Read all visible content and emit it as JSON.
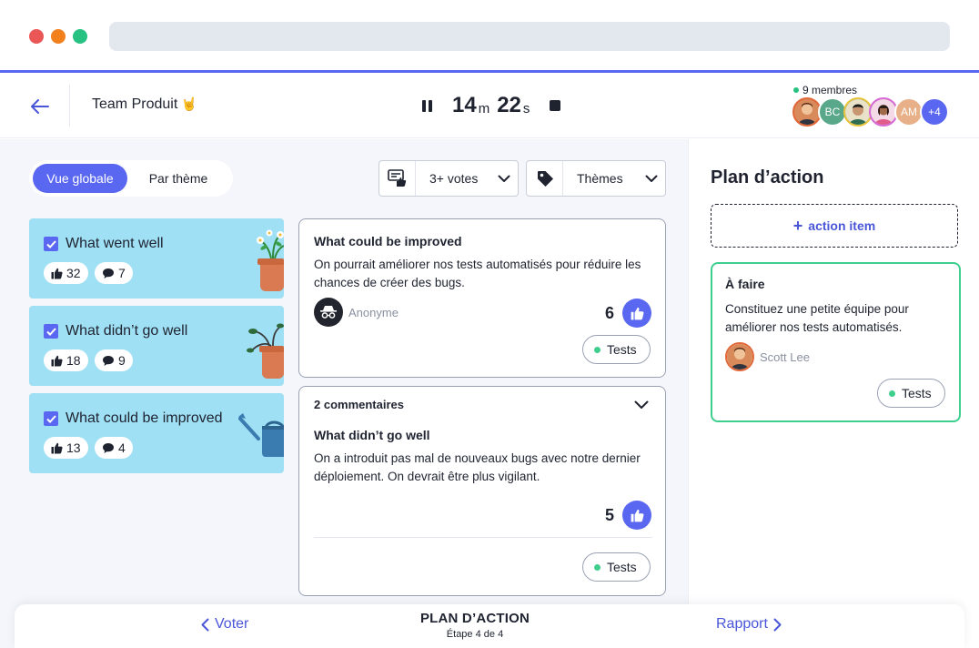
{
  "header": {
    "team_name": "Team Produit",
    "team_emoji": "🤘",
    "timer_minutes": "14",
    "timer_minutes_unit": "m",
    "timer_seconds": "22",
    "timer_seconds_unit": "s",
    "members_label": "9 membres",
    "avatars": [
      {
        "initials": "",
        "color": "#c8704a"
      },
      {
        "initials": "BC",
        "color": "#5aa88a"
      },
      {
        "initials": "",
        "color": "#3b7a5f"
      },
      {
        "initials": "",
        "color": "#b65a8a"
      },
      {
        "initials": "AM",
        "color": "#e8b088"
      },
      {
        "initials": "+4",
        "color": "#5a67f0"
      }
    ]
  },
  "view_toggle": {
    "active_label": "Vue globale",
    "inactive_label": "Par thème"
  },
  "filters": {
    "votes_label": "3+ votes",
    "themes_label": "Thèmes"
  },
  "categories": [
    {
      "title": "What went well",
      "likes": "32",
      "comments": "7"
    },
    {
      "title": "What didn’t go well",
      "likes": "18",
      "comments": "9"
    },
    {
      "title": "What could be improved",
      "likes": "13",
      "comments": "4"
    }
  ],
  "cards": [
    {
      "title": "What could be improved",
      "text": "On pourrait améliorer nos tests automatisés pour réduire les chances de créer des bugs.",
      "author": "Anonyme",
      "votes": "6",
      "tag": "Tests"
    },
    {
      "comments_label": "2 commentaires",
      "title": "What didn’t go well",
      "text": "On a introduit pas mal de nouveaux bugs avec notre dernier déploiement. On devrait être plus vigilant.",
      "votes": "5",
      "tag": "Tests"
    }
  ],
  "sidebar": {
    "title": "Plan d’action",
    "add_label": "action item",
    "todo": {
      "status": "À faire",
      "text": "Constituez une petite équipe pour améliorer nos tests automatisés.",
      "assignee": "Scott Lee",
      "tag": "Tests"
    }
  },
  "footer": {
    "prev_label": "Voter",
    "step_title": "PLAN D’ACTION",
    "step_subtitle": "Étape 4 de 4",
    "next_label": "Rapport"
  },
  "colors": {
    "accent": "#5a67f0",
    "category_bg": "#9fe0f5",
    "success": "#3ecf8e"
  }
}
